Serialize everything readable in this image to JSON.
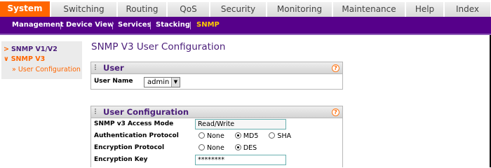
{
  "top_tabs": [
    {
      "label": "System",
      "active": true
    },
    {
      "label": "Switching",
      "active": false
    },
    {
      "label": "Routing",
      "active": false
    },
    {
      "label": "QoS",
      "active": false
    },
    {
      "label": "Security",
      "active": false
    },
    {
      "label": "Monitoring",
      "active": false
    },
    {
      "label": "Maintenance",
      "active": false
    },
    {
      "label": "Help",
      "active": false
    },
    {
      "label": "Index",
      "active": false
    }
  ],
  "sub_nav": [
    {
      "label": "Management",
      "active": false
    },
    {
      "label": "Device View",
      "active": false
    },
    {
      "label": "Services",
      "active": false
    },
    {
      "label": "Stacking",
      "active": false
    },
    {
      "label": "SNMP",
      "active": true
    }
  ],
  "sidebar": {
    "items": [
      {
        "label": "SNMP V1/V2",
        "arrow": ">"
      },
      {
        "label": "SNMP V3",
        "arrow": "∨"
      },
      {
        "label": "User Configuration",
        "arrow": "»"
      }
    ]
  },
  "page_title": "SNMP V3 User Configuration",
  "user_section": {
    "title": "User",
    "user_name_label": "User Name",
    "user_name_value": "admin"
  },
  "config_section": {
    "title": "User Configuration",
    "access_mode_label": "SNMP v3 Access Mode",
    "access_mode_value": "Read/Write",
    "auth_label": "Authentication Protocol",
    "auth_options": [
      "None",
      "MD5",
      "SHA"
    ],
    "auth_selected": "MD5",
    "enc_label": "Encryption Protocol",
    "enc_options": [
      "None",
      "DES"
    ],
    "enc_selected": "DES",
    "enc_key_label": "Encryption Key",
    "enc_key_value": "********"
  },
  "help_glyph": "?",
  "colors": {
    "active_tab": "#ff6600",
    "sub_nav_bg": "#56008a",
    "sub_nav_active": "#ffcc00",
    "title_purple": "#4b1e7a",
    "sidebar_active": "#ff6600"
  }
}
